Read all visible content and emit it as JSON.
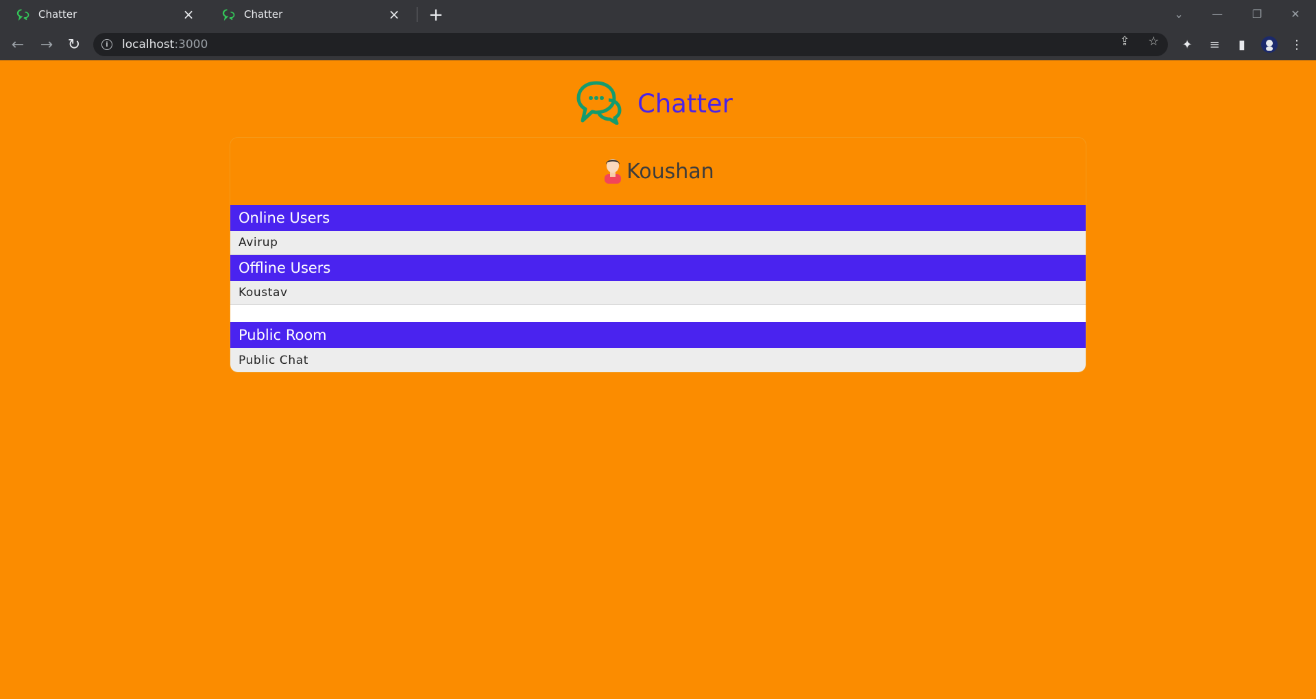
{
  "browser": {
    "tabs": [
      {
        "title": "Chatter"
      },
      {
        "title": "Chatter"
      }
    ],
    "url_host": "localhost",
    "url_port": ":3000"
  },
  "app": {
    "brand_name": "Chatter",
    "brand_color": "#4a23e8",
    "icon_color": "#159b6e",
    "current_user": "Koushan"
  },
  "sections": {
    "online": {
      "title": "Online Users",
      "users": [
        "Avirup"
      ]
    },
    "offline": {
      "title": "Offline Users",
      "users": [
        "Koustav"
      ]
    },
    "rooms": {
      "title": "Public Room",
      "items": [
        "Public Chat"
      ]
    }
  },
  "colors": {
    "page_bg": "#fb8c00",
    "section_header_bg": "#4a23ef",
    "row_bg": "#ededed"
  }
}
